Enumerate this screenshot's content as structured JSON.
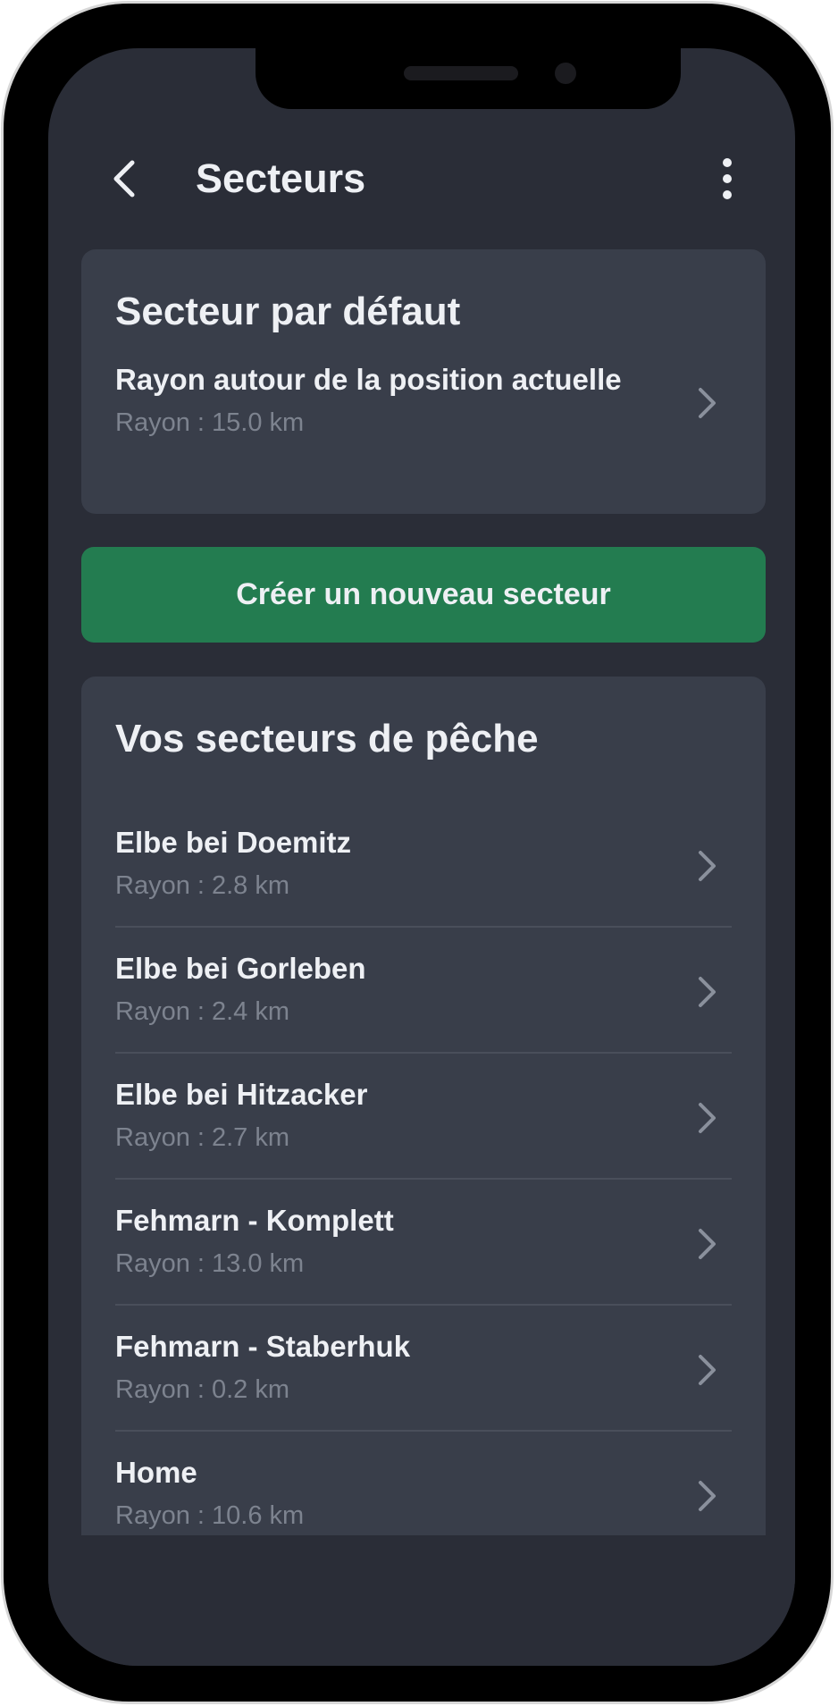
{
  "header": {
    "title": "Secteurs",
    "back_icon": "chevron-left-icon",
    "menu_icon": "more-vertical-icon"
  },
  "default_sector": {
    "heading": "Secteur par défaut",
    "item": {
      "name": "Rayon autour de la position actuelle",
      "radius": "Rayon : 15.0 km"
    }
  },
  "create_button": {
    "label": "Créer un nouveau secteur",
    "color": "#237c50"
  },
  "sectors": {
    "heading": "Vos secteurs de pêche",
    "items": [
      {
        "name": "Elbe bei Doemitz",
        "radius": "Rayon : 2.8 km"
      },
      {
        "name": "Elbe bei Gorleben",
        "radius": "Rayon : 2.4 km"
      },
      {
        "name": "Elbe bei Hitzacker",
        "radius": "Rayon : 2.7 km"
      },
      {
        "name": "Fehmarn - Komplett",
        "radius": "Rayon : 13.0 km"
      },
      {
        "name": "Fehmarn - Staberhuk",
        "radius": "Rayon : 0.2 km"
      },
      {
        "name": "Home",
        "radius": "Rayon : 10.6 km"
      }
    ]
  },
  "colors": {
    "background": "#2a2d37",
    "card": "#393e4a",
    "text_primary": "#eef0f4",
    "text_secondary": "#7d838f"
  }
}
